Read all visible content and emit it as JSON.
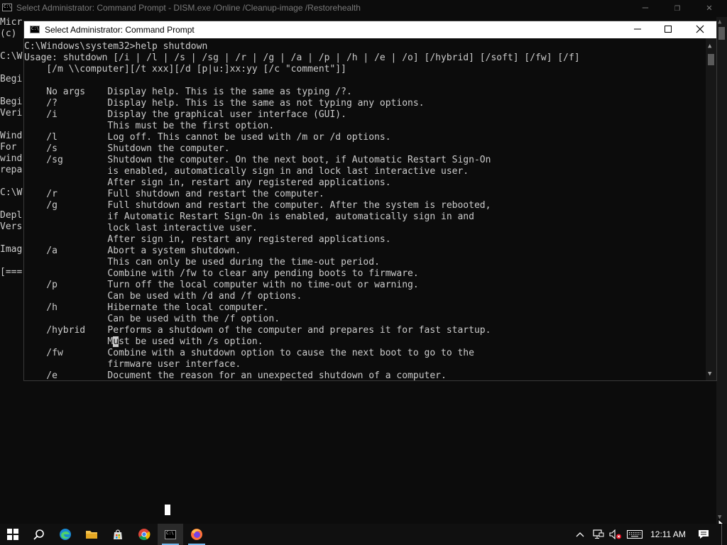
{
  "back_window": {
    "title": "Select Administrator: Command Prompt - DISM.exe  /Online /Cleanup-image /Restorehealth",
    "visible_lines": [
      "Micr",
      "(c) ",
      "",
      "C:\\W",
      "",
      "Begi",
      "",
      "Begi",
      "Veri",
      "",
      "Wind",
      "For ",
      "wind",
      "repa",
      "",
      "C:\\W",
      "",
      "Depl",
      "Vers",
      "",
      "Imag",
      "",
      "[===",
      "",
      "",
      "",
      ""
    ]
  },
  "front_window": {
    "title": "Select Administrator: Command Prompt",
    "console_lines": [
      "C:\\Windows\\system32>help shutdown",
      "Usage: shutdown [/i | /l | /s | /sg | /r | /g | /a | /p | /h | /e | /o] [/hybrid] [/soft] [/fw] [/f]",
      "    [/m \\\\computer][/t xxx][/d [p|u:]xx:yy [/c \"comment\"]]",
      "",
      "    No args    Display help. This is the same as typing /?.",
      "    /?         Display help. This is the same as not typing any options.",
      "    /i         Display the graphical user interface (GUI).",
      "               This must be the first option.",
      "    /l         Log off. This cannot be used with /m or /d options.",
      "    /s         Shutdown the computer.",
      "    /sg        Shutdown the computer. On the next boot, if Automatic Restart Sign-On",
      "               is enabled, automatically sign in and lock last interactive user.",
      "               After sign in, restart any registered applications.",
      "    /r         Full shutdown and restart the computer.",
      "    /g         Full shutdown and restart the computer. After the system is rebooted,",
      "               if Automatic Restart Sign-On is enabled, automatically sign in and",
      "               lock last interactive user.",
      "               After sign in, restart any registered applications.",
      "    /a         Abort a system shutdown.",
      "               This can only be used during the time-out period.",
      "               Combine with /fw to clear any pending boots to firmware.",
      "    /p         Turn off the local computer with no time-out or warning.",
      "               Can be used with /d and /f options.",
      "    /h         Hibernate the local computer.",
      "               Can be used with the /f option.",
      "    /hybrid    Performs a shutdown of the computer and prepares it for fast startup.",
      "               Must be used with /s option.",
      "    /fw        Combine with a shutdown option to cause the next boot to go to the",
      "               firmware user interface.",
      "    /e         Document the reason for an unexpected shutdown of a computer."
    ],
    "caret": {
      "line": 26,
      "column": 16
    }
  },
  "taskbar": {
    "items": [
      {
        "name": "start-button",
        "icon": "windows-logo-icon"
      },
      {
        "name": "search-button",
        "icon": "search-icon"
      },
      {
        "name": "edge-button",
        "icon": "edge-icon"
      },
      {
        "name": "file-explorer-button",
        "icon": "folder-icon"
      },
      {
        "name": "store-button",
        "icon": "store-icon"
      },
      {
        "name": "chrome-button",
        "icon": "chrome-icon"
      },
      {
        "name": "cmd-button",
        "icon": "cmd-icon",
        "active": true
      },
      {
        "name": "firefox-button",
        "icon": "firefox-icon"
      }
    ],
    "tray": {
      "icons": [
        "chevron-up-icon",
        "network-icon",
        "volume-muted-icon",
        "keyboard-icon"
      ],
      "clock": "12:11 AM"
    }
  },
  "colors": {
    "console_bg": "#0c0c0c",
    "console_text": "#cccccc",
    "titlebar_active": "#ffffff",
    "taskbar_bg": "#101010",
    "taskbar_accent": "#76b9ed"
  }
}
